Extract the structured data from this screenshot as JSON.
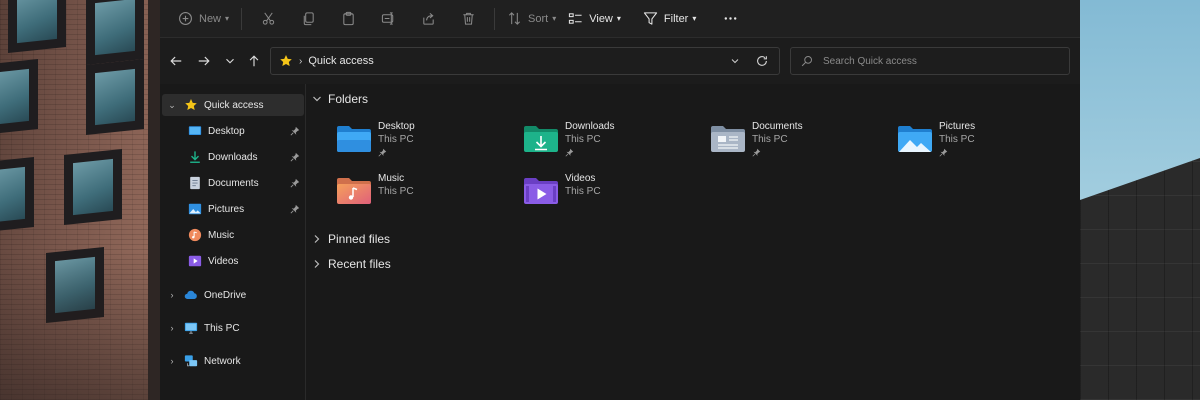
{
  "toolbar": {
    "new_label": "New",
    "sort_label": "Sort",
    "view_label": "View",
    "filter_label": "Filter"
  },
  "address": {
    "path": "Quick access"
  },
  "search": {
    "placeholder": "Search Quick access"
  },
  "sidebar": {
    "items": [
      {
        "label": "Quick access",
        "icon": "star-icon"
      },
      {
        "label": "Desktop",
        "icon": "desktop-icon"
      },
      {
        "label": "Downloads",
        "icon": "download-icon"
      },
      {
        "label": "Documents",
        "icon": "documents-icon"
      },
      {
        "label": "Pictures",
        "icon": "pictures-icon"
      },
      {
        "label": "Music",
        "icon": "music-icon"
      },
      {
        "label": "Videos",
        "icon": "videos-icon"
      },
      {
        "label": "OneDrive",
        "icon": "cloud-icon"
      },
      {
        "label": "This PC",
        "icon": "monitor-icon"
      },
      {
        "label": "Network",
        "icon": "network-icon"
      }
    ]
  },
  "content": {
    "folders_heading": "Folders",
    "pinned_heading": "Pinned files",
    "recent_heading": "Recent files",
    "folders": [
      {
        "name": "Desktop",
        "location": "This PC",
        "pinned": true
      },
      {
        "name": "Downloads",
        "location": "This PC",
        "pinned": true
      },
      {
        "name": "Documents",
        "location": "This PC",
        "pinned": true
      },
      {
        "name": "Pictures",
        "location": "This PC",
        "pinned": true
      },
      {
        "name": "Music",
        "location": "This PC",
        "pinned": false
      },
      {
        "name": "Videos",
        "location": "This PC",
        "pinned": false
      }
    ]
  },
  "colors": {
    "accent_blue": "#3fa9f5",
    "downloads_green": "#1db38a",
    "music_orange": "#f08a5d",
    "videos_purple": "#8a5ce6",
    "star_yellow": "#f5c518"
  }
}
